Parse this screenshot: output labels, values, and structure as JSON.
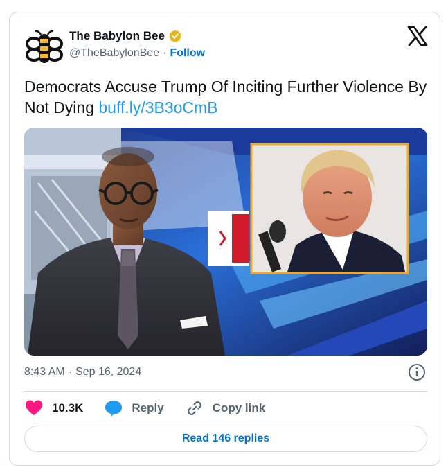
{
  "author": {
    "name": "The Babylon Bee",
    "handle": "@TheBabylonBee",
    "separator": "·",
    "follow_label": "Follow",
    "verified_color": "#e2b719"
  },
  "platform_icon": "x-logo-icon",
  "tweet": {
    "text": "Democrats Accuse Trump Of Inciting Further Violence By Not Dying",
    "link": "buff.ly/3B3oCmB"
  },
  "media": {
    "description_icon": "news-broadcast-image"
  },
  "meta": {
    "time": "8:43 AM",
    "separator": "·",
    "date": "Sep 16, 2024"
  },
  "actions": {
    "likes_count": "10.3K",
    "reply_label": "Reply",
    "copy_link_label": "Copy link"
  },
  "replies_button": "Read 146 replies",
  "colors": {
    "link": "#1d9bf0",
    "follow": "#006fd6",
    "like": "#f91880",
    "reply": "#1d9bf0",
    "border": "#cfd9de",
    "muted": "#536471"
  }
}
